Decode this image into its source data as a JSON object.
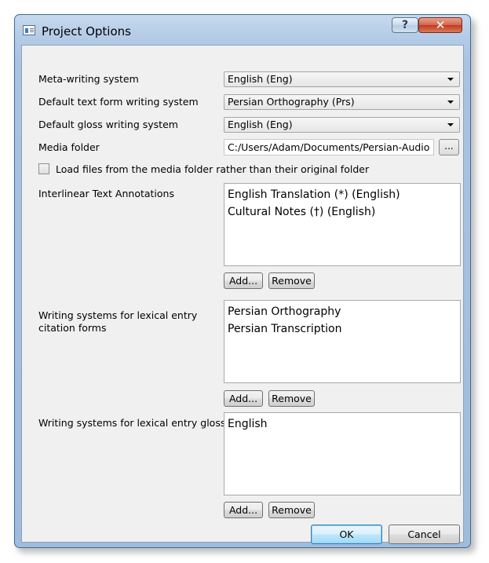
{
  "window": {
    "title": "Project Options",
    "help_label": "?",
    "close_label": "✕"
  },
  "form": {
    "meta_writing_system": {
      "label": "Meta-writing system",
      "value": "English (Eng)"
    },
    "default_text_form_ws": {
      "label": "Default text form writing system",
      "value": "Persian Orthography (Prs)"
    },
    "default_gloss_ws": {
      "label": "Default gloss writing system",
      "value": "English (Eng)"
    },
    "media_folder": {
      "label": "Media folder",
      "value": "C:/Users/Adam/Documents/Persian-Audio",
      "browse_label": "..."
    },
    "load_files_checkbox": {
      "label": "Load files from the media folder rather than their original folder",
      "checked": false
    }
  },
  "interlinear": {
    "label": "Interlinear Text Annotations",
    "items": [
      "English Translation (*) (English)",
      "Cultural Notes (†) (English)"
    ],
    "add_label": "Add...",
    "remove_label": "Remove"
  },
  "citation_forms": {
    "label": "Writing systems for lexical entry citation forms",
    "items": [
      "Persian Orthography",
      "Persian Transcription"
    ],
    "add_label": "Add...",
    "remove_label": "Remove"
  },
  "glosses": {
    "label": "Writing systems for lexical entry glosses",
    "items": [
      "English"
    ],
    "add_label": "Add...",
    "remove_label": "Remove"
  },
  "footer": {
    "ok_label": "OK",
    "cancel_label": "Cancel"
  }
}
